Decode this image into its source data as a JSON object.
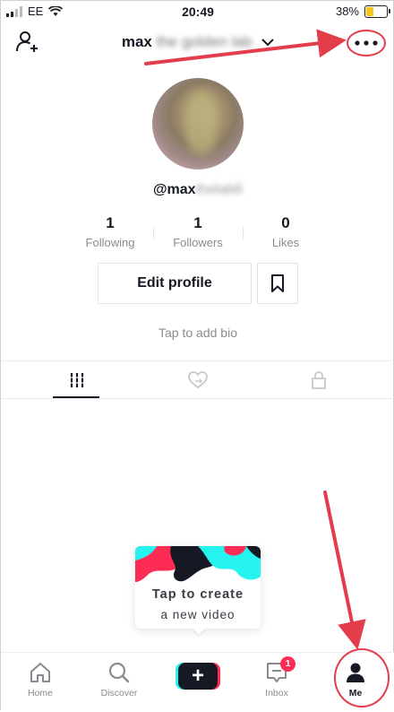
{
  "status": {
    "carrier": "EE",
    "time": "20:49",
    "battery": "38%",
    "battery_level": 0.38
  },
  "header": {
    "title": "max",
    "title_blurred": "the golden lab"
  },
  "profile": {
    "username": "@max",
    "username_blurred": "thelab6",
    "stats": [
      {
        "value": "1",
        "label": "Following"
      },
      {
        "value": "1",
        "label": "Followers"
      },
      {
        "value": "0",
        "label": "Likes"
      }
    ],
    "edit_label": "Edit profile",
    "bio_placeholder": "Tap to add bio"
  },
  "tabs": [
    {
      "icon": "grid-icon",
      "active": true
    },
    {
      "icon": "liked-heart-icon",
      "active": false
    },
    {
      "icon": "lock-icon",
      "active": false
    }
  ],
  "tooltip": {
    "line1": "Tap to create",
    "line2": "a new video"
  },
  "nav": {
    "items": [
      {
        "label": "Home",
        "icon": "home-icon"
      },
      {
        "label": "Discover",
        "icon": "search-icon"
      },
      {
        "label": "",
        "icon": "create-plus-icon"
      },
      {
        "label": "Inbox",
        "icon": "inbox-icon",
        "badge": "1"
      },
      {
        "label": "Me",
        "icon": "person-icon",
        "active": true
      }
    ]
  },
  "colors": {
    "accent": "#fe2c55",
    "teal": "#25f4ee",
    "annotation": "#e33d4c"
  }
}
